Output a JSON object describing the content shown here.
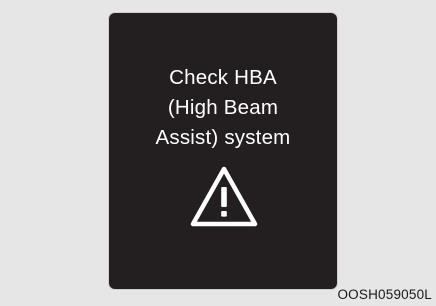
{
  "display": {
    "message_lines": [
      "Check HBA",
      "(High Beam",
      "Assist) system"
    ],
    "icon": "warning-triangle-icon",
    "background_color": "#231f20",
    "text_color": "#ffffff"
  },
  "figure_code": "OOSH059050L"
}
